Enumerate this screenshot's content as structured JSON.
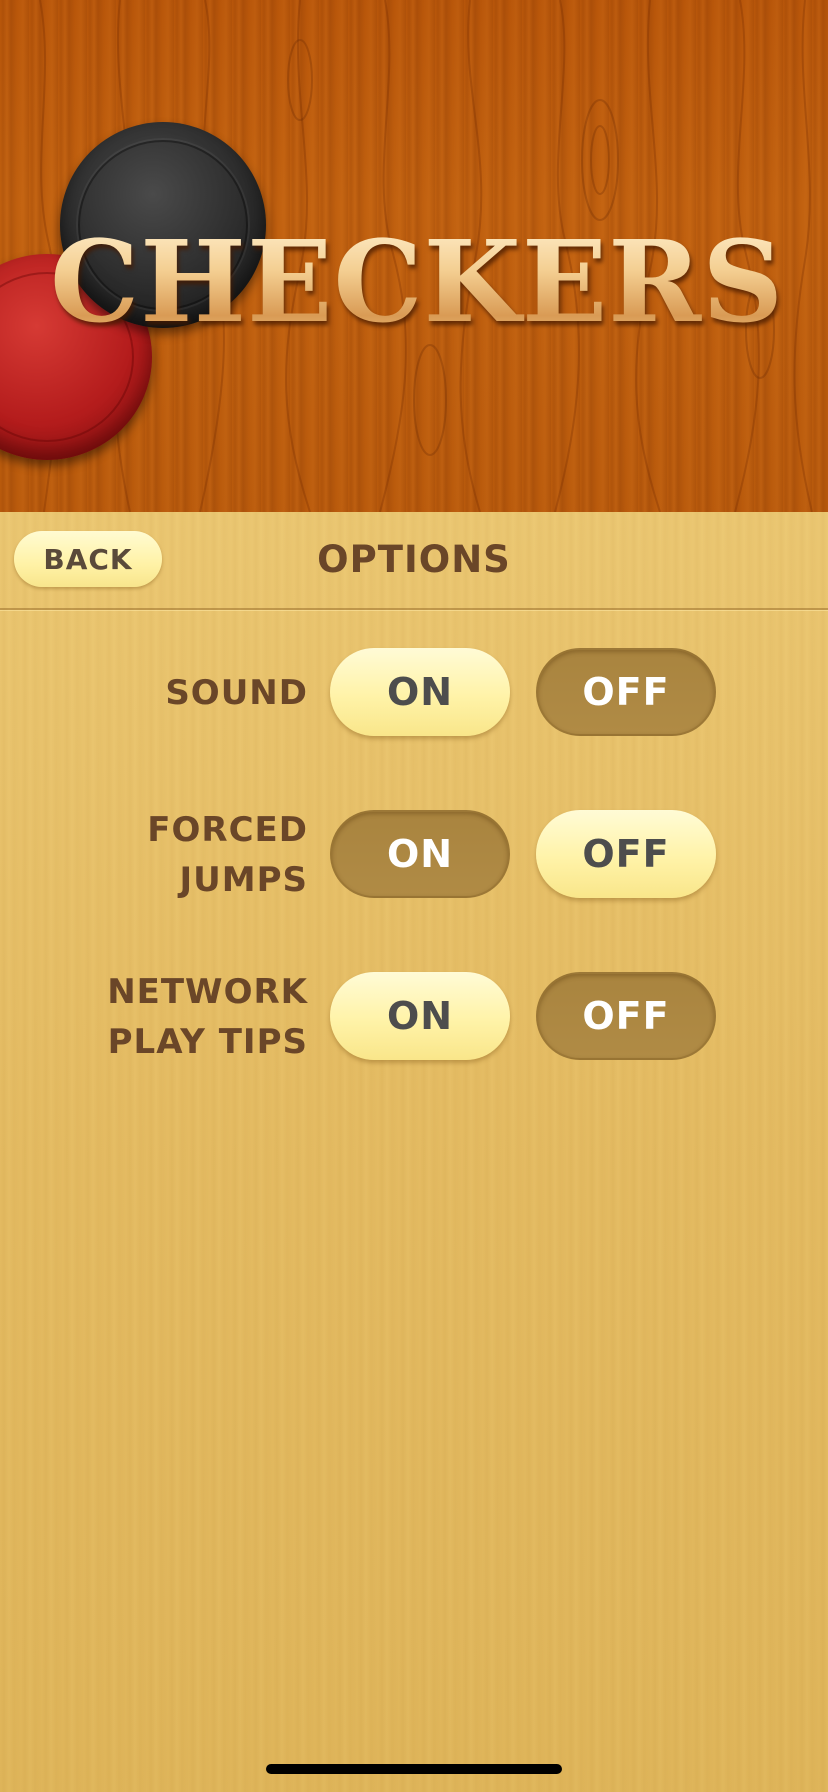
{
  "header": {
    "title": "CHECKERS"
  },
  "topbar": {
    "back_label": "BACK",
    "title": "OPTIONS"
  },
  "options": [
    {
      "label": "SOUND",
      "on_label": "ON",
      "off_label": "OFF",
      "selected": "ON"
    },
    {
      "label": "FORCED\nJUMPS",
      "on_label": "ON",
      "off_label": "OFF",
      "selected": "OFF"
    },
    {
      "label": "NETWORK\nPLAY TIPS",
      "on_label": "ON",
      "off_label": "OFF",
      "selected": "ON"
    }
  ],
  "colors": {
    "header_wood": "#b8560a",
    "panel_wood": "#e4bb62",
    "active_button": "#fff3a8",
    "inactive_button": "#ad8842",
    "label_text": "#6a4628"
  },
  "icons": {
    "black_checker": "black-checker-piece-icon",
    "red_checker": "red-checker-piece-icon"
  }
}
